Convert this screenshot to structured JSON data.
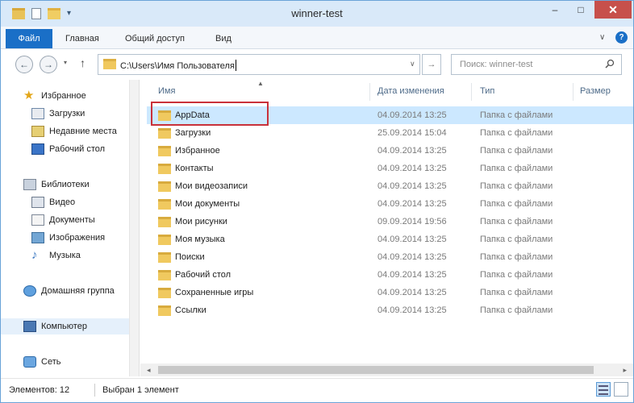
{
  "window": {
    "title": "winner-test"
  },
  "ribbon": {
    "tabs": [
      {
        "label": "Файл",
        "active": true
      },
      {
        "label": "Главная"
      },
      {
        "label": "Общий доступ"
      },
      {
        "label": "Вид"
      }
    ]
  },
  "address": {
    "path": "C:\\Users\\Имя Пользователя"
  },
  "search": {
    "placeholder": "Поиск: winner-test"
  },
  "navpane": {
    "items": [
      {
        "label": "Избранное",
        "icon": "star-icon"
      },
      {
        "label": "Загрузки",
        "icon": "downloads-icon"
      },
      {
        "label": "Недавние места",
        "icon": "recent-places-icon"
      },
      {
        "label": "Рабочий стол",
        "icon": "desktop-icon"
      },
      {
        "label": "Библиотеки",
        "icon": "libraries-icon"
      },
      {
        "label": "Видео",
        "icon": "video-icon"
      },
      {
        "label": "Документы",
        "icon": "documents-icon"
      },
      {
        "label": "Изображения",
        "icon": "pictures-icon"
      },
      {
        "label": "Музыка",
        "icon": "music-icon"
      },
      {
        "label": "Домашняя группа",
        "icon": "homegroup-icon"
      },
      {
        "label": "Компьютер",
        "icon": "computer-icon",
        "selected": true
      },
      {
        "label": "Сеть",
        "icon": "network-icon"
      }
    ]
  },
  "columns": {
    "name": "Имя",
    "date": "Дата изменения",
    "type": "Тип",
    "size": "Размер"
  },
  "files": [
    {
      "name": "AppData",
      "date": "04.09.2014 13:25",
      "type": "Папка с файлами",
      "selected": true
    },
    {
      "name": "Загрузки",
      "date": "25.09.2014 15:04",
      "type": "Папка с файлами"
    },
    {
      "name": "Избранное",
      "date": "04.09.2014 13:25",
      "type": "Папка с файлами"
    },
    {
      "name": "Контакты",
      "date": "04.09.2014 13:25",
      "type": "Папка с файлами"
    },
    {
      "name": "Мои видеозаписи",
      "date": "04.09.2014 13:25",
      "type": "Папка с файлами"
    },
    {
      "name": "Мои документы",
      "date": "04.09.2014 13:25",
      "type": "Папка с файлами"
    },
    {
      "name": "Мои рисунки",
      "date": "09.09.2014 19:56",
      "type": "Папка с файлами"
    },
    {
      "name": "Моя музыка",
      "date": "04.09.2014 13:25",
      "type": "Папка с файлами"
    },
    {
      "name": "Поиски",
      "date": "04.09.2014 13:25",
      "type": "Папка с файлами"
    },
    {
      "name": "Рабочий стол",
      "date": "04.09.2014 13:25",
      "type": "Папка с файлами"
    },
    {
      "name": "Сохраненные игры",
      "date": "04.09.2014 13:25",
      "type": "Папка с файлами"
    },
    {
      "name": "Ссылки",
      "date": "04.09.2014 13:25",
      "type": "Папка с файлами"
    }
  ],
  "status": {
    "count": "Элементов: 12",
    "selection": "Выбран 1 элемент"
  }
}
